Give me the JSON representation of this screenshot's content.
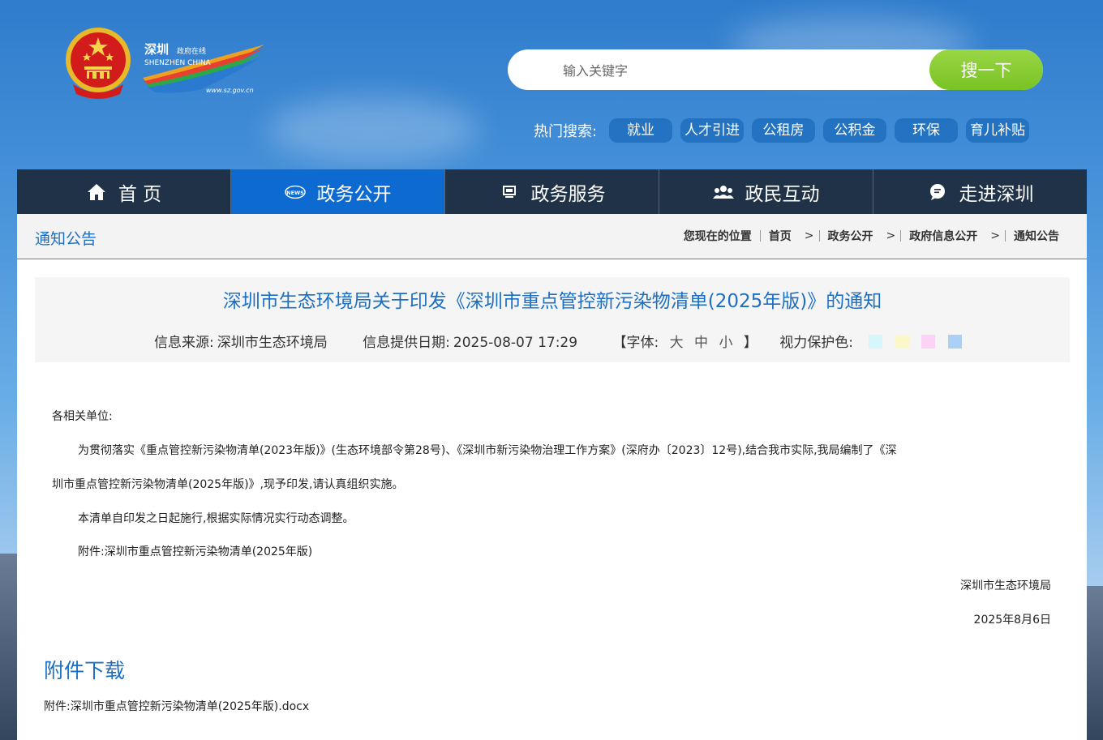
{
  "header": {
    "logo_text_cn": "深圳 政府在线",
    "logo_text_en": "SHENZHEN CHINA",
    "logo_url": "www.sz.gov.cn",
    "search": {
      "placeholder": "输入关键字",
      "button_label": "搜一下"
    },
    "hot_search": {
      "label": "热门搜索:",
      "tags": [
        "就业",
        "人才引进",
        "公租房",
        "公积金",
        "环保",
        "育儿补贴"
      ]
    }
  },
  "nav": {
    "items": [
      {
        "label": "首 页",
        "icon": "home-icon"
      },
      {
        "label": "政务公开",
        "icon": "news-icon"
      },
      {
        "label": "政务服务",
        "icon": "monitor-icon"
      },
      {
        "label": "政民互动",
        "icon": "people-icon"
      },
      {
        "label": "走进深圳",
        "icon": "chat-icon"
      }
    ],
    "active_index": 1
  },
  "section": {
    "title": "通知公告",
    "breadcrumb": {
      "label": "您现在的位置",
      "items": [
        "首页",
        "政务公开",
        "政府信息公开",
        "通知公告"
      ]
    }
  },
  "article": {
    "title": "深圳市生态环境局关于印发《深圳市重点管控新污染物清单(2025年版)》的通知",
    "source_label": "信息来源:",
    "source": "深圳市生态环境局",
    "date_label": "信息提供日期:",
    "date": "2025-08-07 17:29",
    "font_label": "【字体:",
    "font_sizes": [
      "大",
      "中",
      "小"
    ],
    "font_close": "】",
    "eye_label": "视力保护色:",
    "eye_colors": [
      "#d5f7fb",
      "#faf7c8",
      "#fcd3f6",
      "#a9d0f5"
    ],
    "salutation": "各相关单位:",
    "paragraph1_line1": "为贯彻落实《重点管控新污染物清单(2023年版)》(生态环境部令第28号)、《深圳市新污染物治理工作方案》(深府办〔2023〕12号),结合我市实际,我局编制了《深",
    "paragraph1_line2": "圳市重点管控新污染物清单(2025年版)》,现予印发,请认真组织实施。",
    "paragraph2": "本清单自印发之日起施行,根据实际情况实行动态调整。",
    "attachment_line": "附件:深圳市重点管控新污染物清单(2025年版)",
    "signature": "深圳市生态环境局",
    "sign_date": "2025年8月6日"
  },
  "attachments": {
    "title": "附件下载",
    "prefix": "附件:",
    "file": "深圳市重点管控新污染物清单(2025年版).docx"
  },
  "colors": {
    "accent_blue": "#1d6fc4",
    "nav_dark": "#1f3247",
    "nav_active": "#0d6ad0",
    "search_green": "#8ccd38",
    "divider_green": "#2ea84a"
  }
}
